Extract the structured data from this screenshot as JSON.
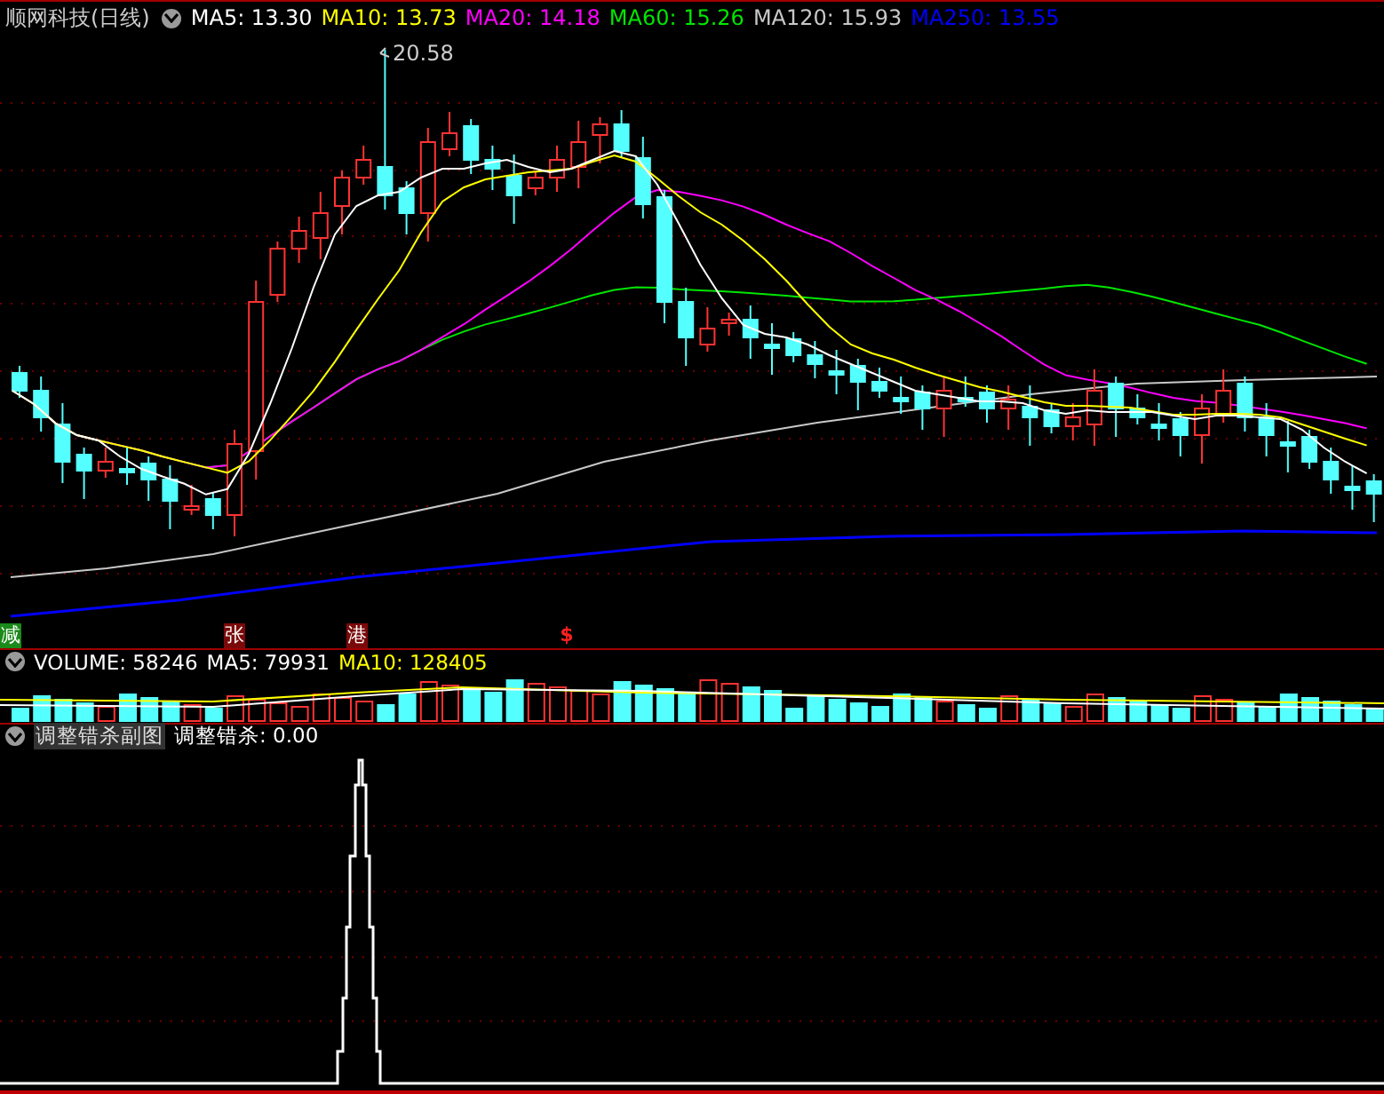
{
  "header": {
    "title": "顺网科技(日线)",
    "indicators": [
      {
        "label": "MA5: 13.30",
        "color": "#ffffff"
      },
      {
        "label": "MA10: 13.73",
        "color": "#ffff00"
      },
      {
        "label": "MA20: 14.18",
        "color": "#ff00ff"
      },
      {
        "label": "MA60: 15.26",
        "color": "#00e600"
      },
      {
        "label": "MA120: 15.93",
        "color": "#c8c8c8"
      },
      {
        "label": "MA250: 13.55",
        "color": "#0000ff"
      }
    ]
  },
  "price_chart": {
    "high_label": "20.58"
  },
  "markers": [
    {
      "text": "减",
      "kind": "green"
    },
    {
      "text": "张",
      "kind": "darkred"
    },
    {
      "text": "港",
      "kind": "darkred"
    },
    {
      "text": "$",
      "kind": "red"
    }
  ],
  "volume": {
    "items": [
      {
        "label": "VOLUME: 58246",
        "color": "#ffffff"
      },
      {
        "label": "MA5: 79931",
        "color": "#ffffff"
      },
      {
        "label": "MA10: 128405",
        "color": "#ffff00"
      }
    ]
  },
  "indicator": {
    "name": "调整错杀副图",
    "readings": [
      "调整错杀: 0.00"
    ]
  }
}
